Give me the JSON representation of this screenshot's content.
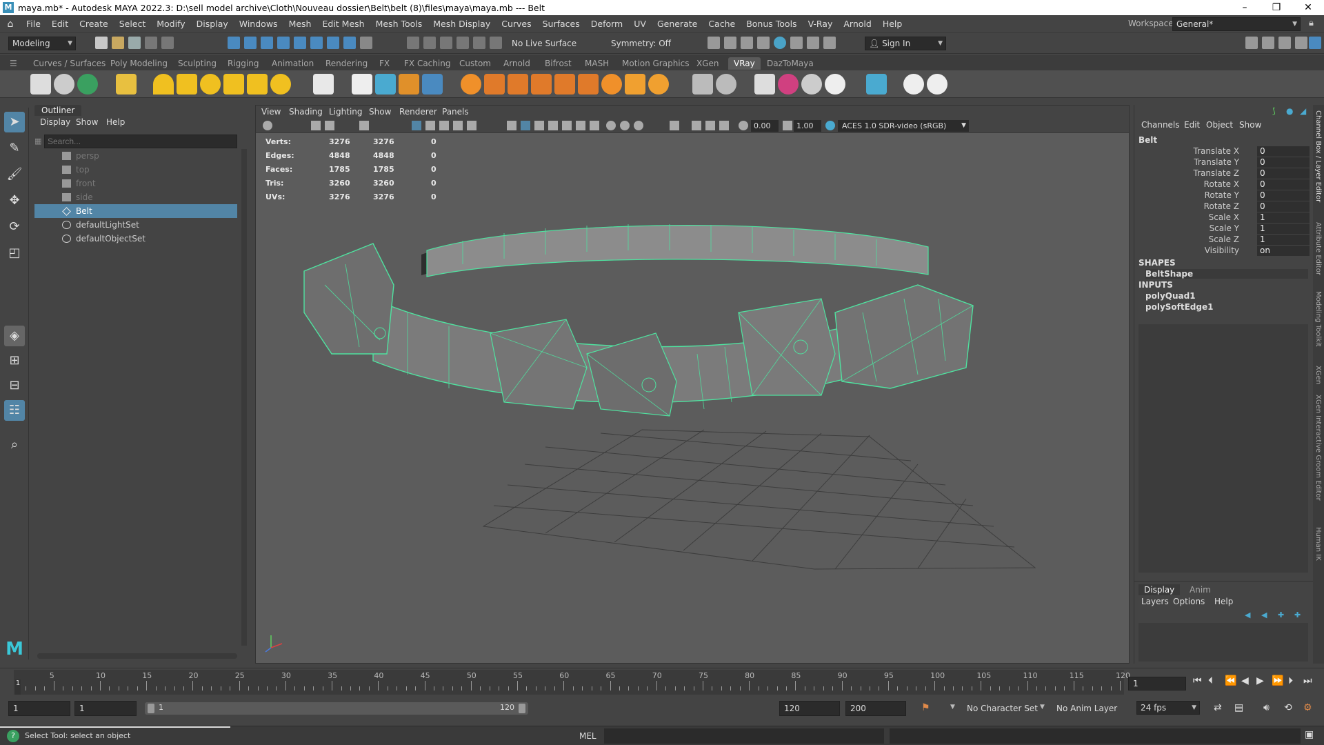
{
  "window": {
    "title": "maya.mb* - Autodesk MAYA 2022.3: D:\\sell model archive\\Cloth\\Nouveau dossier\\Belt\\belt (8)\\files\\maya\\maya.mb  ---  Belt",
    "minimize": "–",
    "maximize": "❐",
    "close": "✕",
    "app_icon": "M"
  },
  "menubar": {
    "items": [
      "File",
      "Edit",
      "Create",
      "Select",
      "Modify",
      "Display",
      "Windows",
      "Mesh",
      "Edit Mesh",
      "Mesh Tools",
      "Mesh Display",
      "Curves",
      "Surfaces",
      "Deform",
      "UV",
      "Generate",
      "Cache",
      "Bonus Tools",
      "V-Ray",
      "Arnold",
      "Help"
    ],
    "workspace_label": "Workspace:",
    "workspace_value": "General*"
  },
  "statusline": {
    "menuset": "Modeling",
    "live_surface": "No Live Surface",
    "symmetry": "Symmetry: Off",
    "sign_in": "Sign In"
  },
  "shelf": {
    "tabs": [
      "Curves / Surfaces",
      "Poly Modeling",
      "Sculpting",
      "Rigging",
      "Animation",
      "Rendering",
      "FX",
      "FX Caching",
      "Custom",
      "Arnold",
      "Bifrost",
      "MASH",
      "Motion Graphics",
      "XGen",
      "VRay",
      "DazToMaya"
    ],
    "active_tab": "VRay"
  },
  "outliner": {
    "title": "Outliner",
    "menu": [
      "Display",
      "Show",
      "Help"
    ],
    "search_placeholder": "Search...",
    "items": [
      {
        "label": "persp",
        "type": "camera",
        "dim": true
      },
      {
        "label": "top",
        "type": "camera",
        "dim": true
      },
      {
        "label": "front",
        "type": "camera",
        "dim": true
      },
      {
        "label": "side",
        "type": "camera",
        "dim": true
      },
      {
        "label": "Belt",
        "type": "mesh",
        "selected": true
      },
      {
        "label": "defaultLightSet",
        "type": "set"
      },
      {
        "label": "defaultObjectSet",
        "type": "set"
      }
    ]
  },
  "viewport": {
    "menu": [
      "View",
      "Shading",
      "Lighting",
      "Show",
      "Renderer",
      "Panels"
    ],
    "exposure": "0.00",
    "gamma": "1.00",
    "colorspace": "ACES 1.0 SDR-video (sRGB)",
    "hud": [
      {
        "label": "Verts:",
        "a": "3276",
        "b": "3276",
        "c": "0"
      },
      {
        "label": "Edges:",
        "a": "4848",
        "b": "4848",
        "c": "0"
      },
      {
        "label": "Faces:",
        "a": "1785",
        "b": "1785",
        "c": "0"
      },
      {
        "label": "Tris:",
        "a": "3260",
        "b": "3260",
        "c": "0"
      },
      {
        "label": "UVs:",
        "a": "3276",
        "b": "3276",
        "c": "0"
      }
    ],
    "wire_color": "#4fe3a0"
  },
  "channelbox": {
    "menu": [
      "Channels",
      "Edit",
      "Object",
      "Show"
    ],
    "object": "Belt",
    "attributes": [
      {
        "name": "Translate X",
        "value": "0"
      },
      {
        "name": "Translate Y",
        "value": "0"
      },
      {
        "name": "Translate Z",
        "value": "0"
      },
      {
        "name": "Rotate X",
        "value": "0"
      },
      {
        "name": "Rotate Y",
        "value": "0"
      },
      {
        "name": "Rotate Z",
        "value": "0"
      },
      {
        "name": "Scale X",
        "value": "1"
      },
      {
        "name": "Scale Y",
        "value": "1"
      },
      {
        "name": "Scale Z",
        "value": "1"
      },
      {
        "name": "Visibility",
        "value": "on"
      }
    ],
    "shapes_label": "SHAPES",
    "shape": "BeltShape",
    "inputs_label": "INPUTS",
    "inputs": [
      "polyQuad1",
      "polySoftEdge1"
    ]
  },
  "layereditor": {
    "tabs": [
      "Display",
      "Anim"
    ],
    "menu": [
      "Layers",
      "Options",
      "Help"
    ]
  },
  "sidetabs": [
    "Channel Box / Layer Editor",
    "Attribute Editor",
    "Modeling Toolkit",
    "XGen",
    "XGen Interactive Groom Editor",
    "Human IK"
  ],
  "timeslider": {
    "labels": [
      "5",
      "10",
      "15",
      "20",
      "25",
      "30",
      "35",
      "40",
      "45",
      "50",
      "55",
      "60",
      "65",
      "70",
      "75",
      "80",
      "85",
      "90",
      "95",
      "100",
      "105",
      "110",
      "115",
      "120"
    ],
    "current_frame": "1",
    "current_field": "1"
  },
  "rangeslider": {
    "start": "1",
    "anim_start": "1",
    "range_start": "1",
    "range_end": "120",
    "end": "120",
    "anim_end": "200",
    "character_set": "No Character Set",
    "anim_layer": "No Anim Layer",
    "fps": "24 fps"
  },
  "helpline": {
    "message": "Select Tool: select an object",
    "script_lang": "MEL"
  }
}
